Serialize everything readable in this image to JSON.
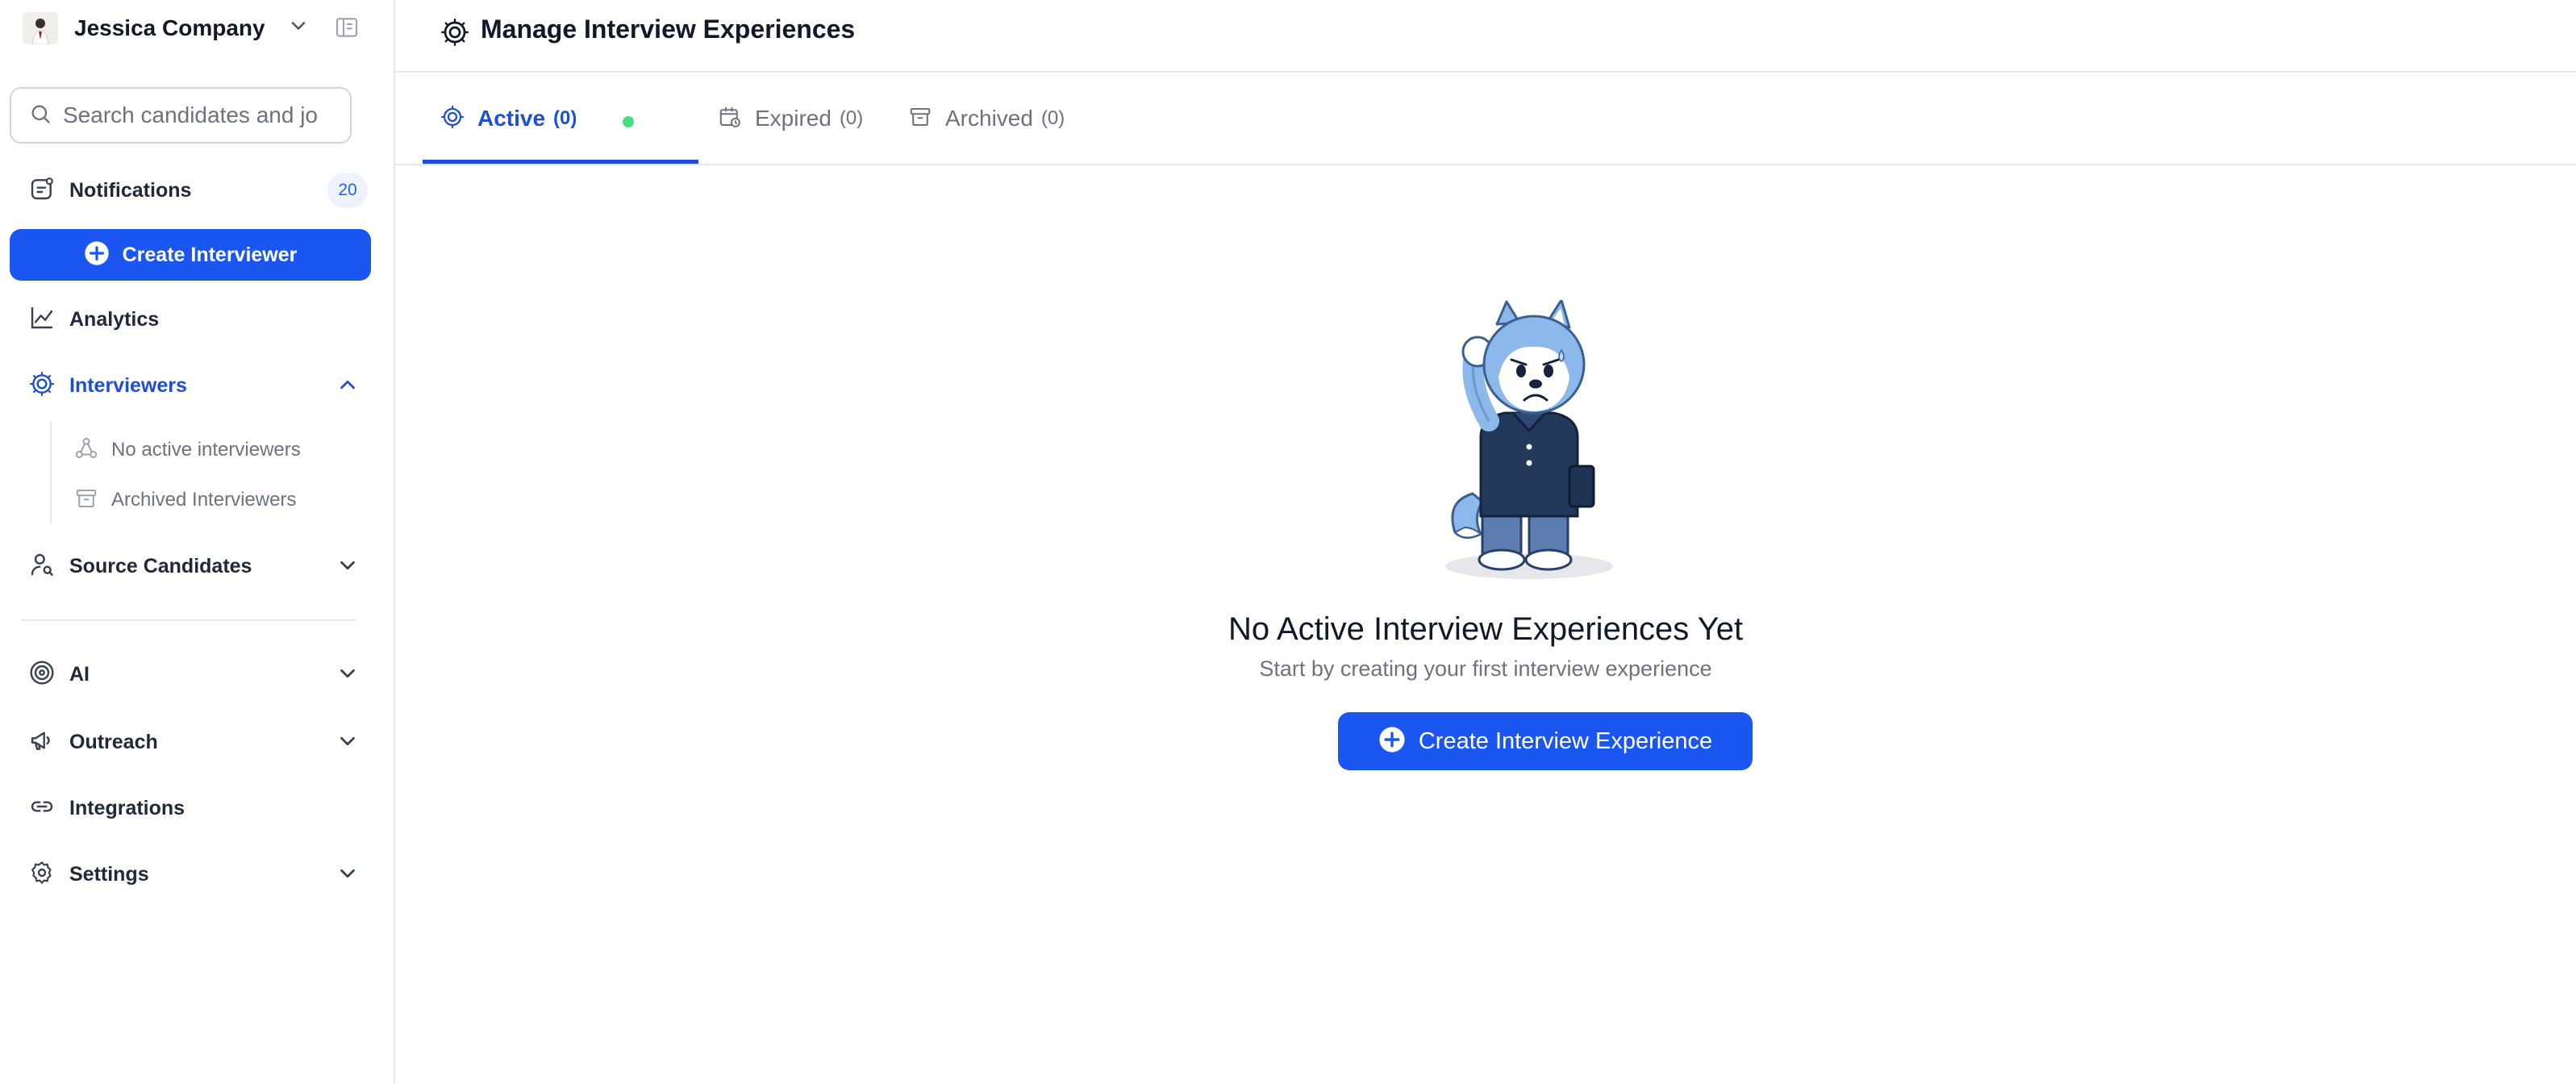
{
  "workspace": {
    "name": "Jessica Company"
  },
  "search": {
    "placeholder": "Search candidates and jo"
  },
  "sidebar": {
    "notifications": {
      "label": "Notifications",
      "count": "20"
    },
    "create_button": "Create Interviewer",
    "analytics": "Analytics",
    "interviewers": {
      "label": "Interviewers",
      "sub_items": [
        "No active interviewers",
        "Archived Interviewers"
      ]
    },
    "source_candidates": "Source Candidates",
    "ai": "AI",
    "outreach": "Outreach",
    "integrations": "Integrations",
    "settings": "Settings"
  },
  "header": {
    "title": "Manage Interview Experiences"
  },
  "tabs": [
    {
      "label": "Active",
      "count": "(0)"
    },
    {
      "label": "Expired",
      "count": "(0)"
    },
    {
      "label": "Archived",
      "count": "(0)"
    }
  ],
  "empty_state": {
    "title": "No Active Interview Experiences Yet",
    "subtitle": "Start by creating your first interview experience",
    "button": "Create Interview Experience"
  },
  "colors": {
    "accent": "#1a56ef",
    "active_tab": "#1d4ed8",
    "status_dot": "#4ade80"
  }
}
